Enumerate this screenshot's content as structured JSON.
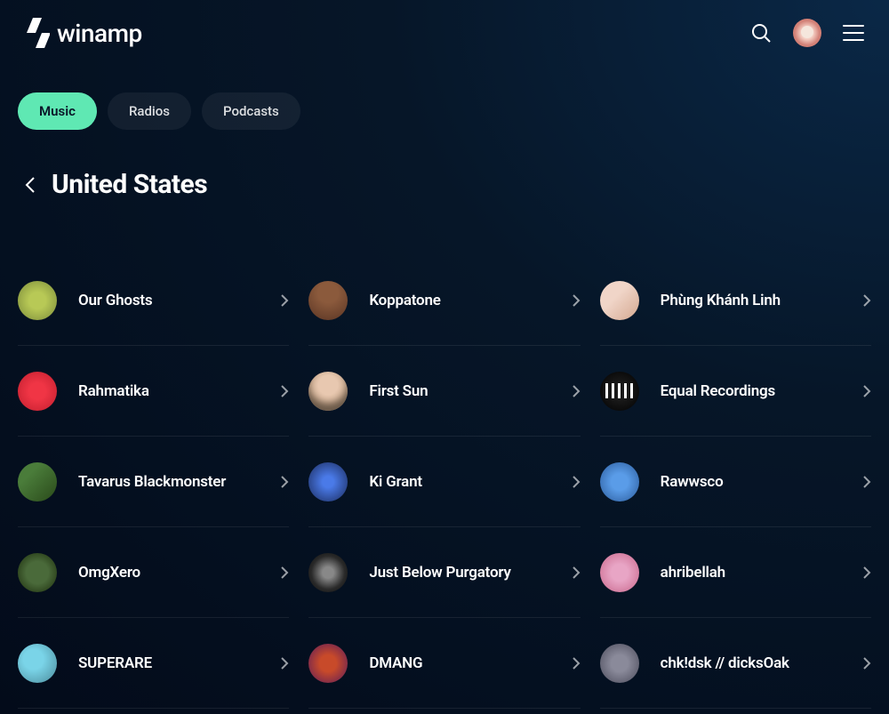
{
  "header": {
    "logo_text": "winamp"
  },
  "tabs": [
    {
      "label": "Music",
      "active": true
    },
    {
      "label": "Radios",
      "active": false
    },
    {
      "label": "Podcasts",
      "active": false
    }
  ],
  "page_title": "United States",
  "artists": [
    {
      "name": "Our Ghosts"
    },
    {
      "name": "Koppatone"
    },
    {
      "name": "Phùng Khánh Linh"
    },
    {
      "name": "Rahmatika"
    },
    {
      "name": "First Sun"
    },
    {
      "name": "Equal Recordings"
    },
    {
      "name": "Tavarus Blackmonster"
    },
    {
      "name": "Ki Grant"
    },
    {
      "name": "Rawwsco"
    },
    {
      "name": "OmgXero"
    },
    {
      "name": "Just Below Purgatory"
    },
    {
      "name": "ahribellah"
    },
    {
      "name": "SUPERARE"
    },
    {
      "name": "DMANG"
    },
    {
      "name": "chk!dsk // dicksOak"
    }
  ]
}
